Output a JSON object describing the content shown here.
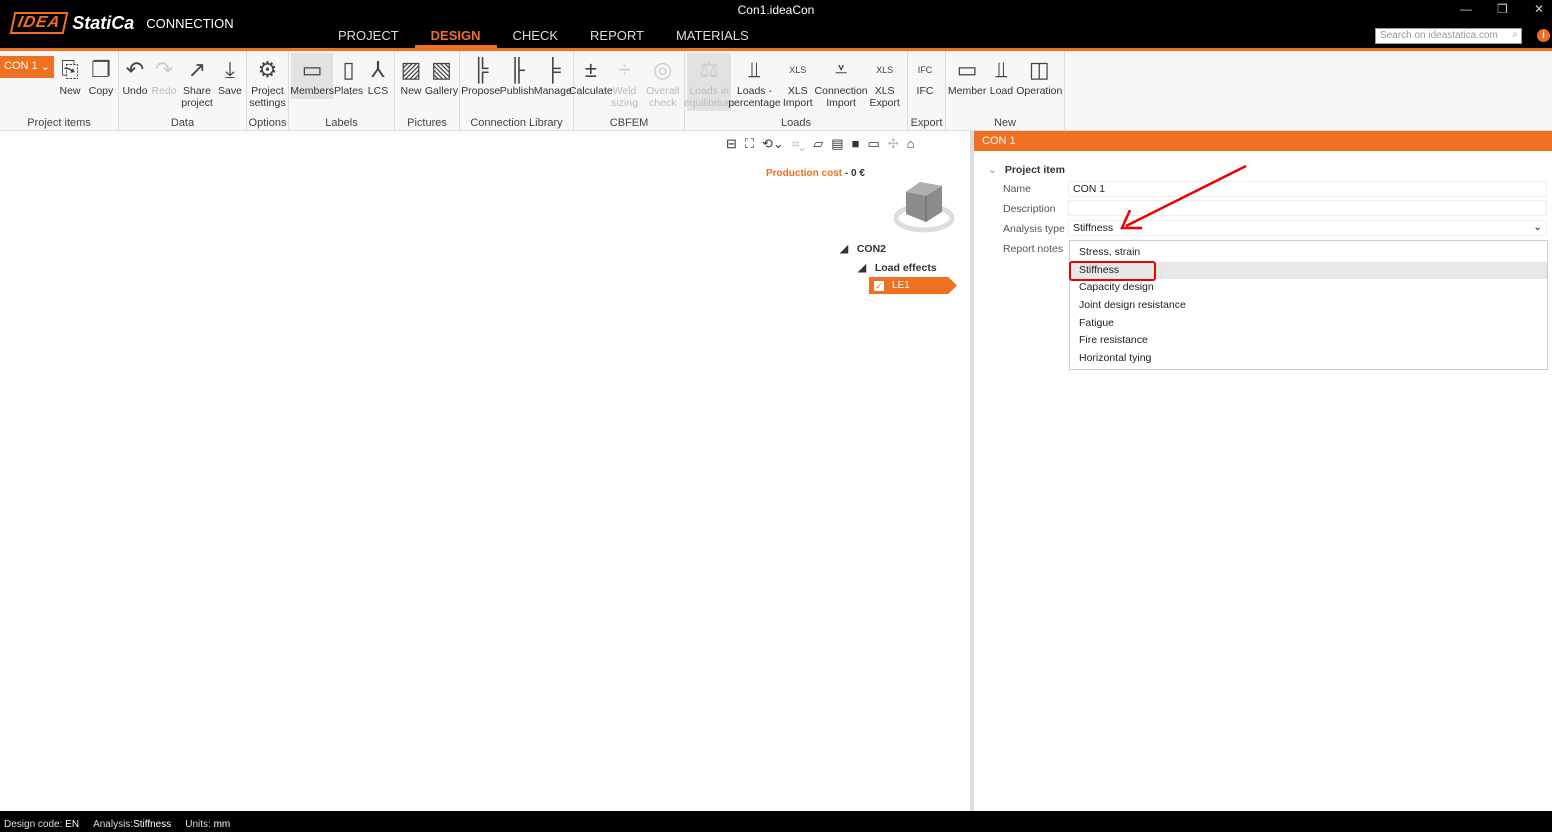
{
  "window": {
    "title": "Con1.ideaCon",
    "minimize": "—",
    "restore": "❐",
    "close": "✕"
  },
  "logo": {
    "idea": "IDEA",
    "statica": "StatiCa",
    "conn": "CONNECTION"
  },
  "tabs": [
    "PROJECT",
    "DESIGN",
    "CHECK",
    "REPORT",
    "MATERIALS"
  ],
  "active_tab": "DESIGN",
  "search": {
    "placeholder": "Search on ideastatica.com",
    "icon": "⌕"
  },
  "info_icon": "i",
  "ribbon": {
    "con_select": "CON 1",
    "groups": [
      {
        "label": "Project items",
        "buttons": [
          {
            "label": "New",
            "icon": "new-item-icon"
          },
          {
            "label": "Copy",
            "icon": "copy-icon"
          }
        ]
      },
      {
        "label": "Data",
        "buttons": [
          {
            "label": "Undo",
            "icon": "undo-icon"
          },
          {
            "label": "Redo",
            "icon": "redo-icon",
            "disabled": true
          },
          {
            "label": "Share project",
            "icon": "share-icon"
          },
          {
            "label": "Save",
            "icon": "save-icon"
          }
        ]
      },
      {
        "label": "Options",
        "buttons": [
          {
            "label": "Project settings",
            "icon": "settings-icon"
          }
        ]
      },
      {
        "label": "Labels",
        "buttons": [
          {
            "label": "Members",
            "icon": "member-icon",
            "selected": true
          },
          {
            "label": "Plates",
            "icon": "plate-icon"
          },
          {
            "label": "LCS",
            "icon": "axes-icon"
          }
        ]
      },
      {
        "label": "Pictures",
        "buttons": [
          {
            "label": "New",
            "icon": "new-picture-icon"
          },
          {
            "label": "Gallery",
            "icon": "gallery-icon"
          }
        ]
      },
      {
        "label": "Connection Library",
        "buttons": [
          {
            "label": "Propose",
            "icon": "propose-icon"
          },
          {
            "label": "Publish",
            "icon": "publish-icon"
          },
          {
            "label": "Manage",
            "icon": "manage-icon"
          }
        ]
      },
      {
        "label": "CBFEM",
        "buttons": [
          {
            "label": "Calculate",
            "icon": "calculate-icon"
          },
          {
            "label": "Weld sizing",
            "icon": "weld-icon",
            "disabled": true
          },
          {
            "label": "Overall check",
            "icon": "check-icon",
            "disabled": true
          }
        ]
      },
      {
        "label": "Loads",
        "buttons": [
          {
            "label": "Loads in equilibrium",
            "icon": "balance-icon",
            "disabled": true,
            "selected": true
          },
          {
            "label": "Loads - percentage",
            "icon": "percent-icon"
          },
          {
            "label": "XLS Import",
            "icon": "xls-import-icon"
          },
          {
            "label": "Connection Import",
            "icon": "connection-import-icon"
          },
          {
            "label": "XLS Export",
            "icon": "xls-export-icon"
          }
        ]
      },
      {
        "label": "Export",
        "buttons": [
          {
            "label": "IFC",
            "icon": "ifc-icon"
          }
        ]
      },
      {
        "label": "New",
        "buttons": [
          {
            "label": "Member",
            "icon": "new-member-icon"
          },
          {
            "label": "Load",
            "icon": "new-load-icon"
          },
          {
            "label": "Operation",
            "icon": "operation-icon"
          }
        ]
      }
    ]
  },
  "viewport": {
    "cost_label": "Production cost",
    "cost_sep": "-",
    "cost_value": "0 €",
    "tree": {
      "root": "CON2",
      "child": "Load effects",
      "leaf": "LE1"
    }
  },
  "panel": {
    "header": "CON 1",
    "section": "Project item",
    "name_label": "Name",
    "name_value": "CON 1",
    "description_label": "Description",
    "description_value": "",
    "analysis_label": "Analysis type",
    "analysis_value": "Stiffness",
    "report_label": "Report notes",
    "options": [
      "Stress, strain",
      "Stiffness",
      "Capacity design",
      "Joint design resistance",
      "Fatigue",
      "Fire resistance",
      "Horizontal tying"
    ],
    "highlighted": "Stiffness"
  },
  "status": {
    "code_label": "Design code:",
    "code": "EN",
    "analysis_label": "Analysis:",
    "analysis": "Stiffness",
    "units_label": "Units:",
    "units": "mm"
  },
  "colors": {
    "accent": "#f07022",
    "annotation": "#e00000"
  }
}
